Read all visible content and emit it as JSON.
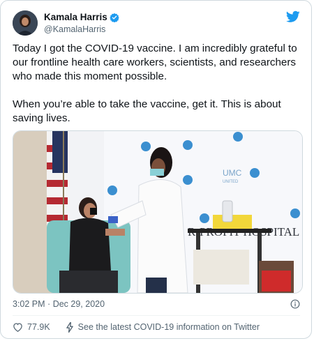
{
  "author": {
    "name": "Kamala Harris",
    "handle": "@KamalaHarris",
    "verified_icon": "verified-badge-icon"
  },
  "brand_color": "#1d9bf0",
  "tweet": {
    "text": "Today I got the COVID-19 vaccine. I am incredibly grateful to our frontline health care workers, scientists, and researchers who made this moment possible.\n\nWhen you’re able to take the vaccine, get it. This is about saving lives.",
    "time": "3:02 PM",
    "separator": "·",
    "date": "Dec 29, 2020"
  },
  "photo": {
    "backdrop_logo": "UMC",
    "backdrop_sub": "UNITED",
    "backdrop_banner": "R-PROFIT HOSPITAL CORPO"
  },
  "actions": {
    "likes": "77.9K",
    "covid_info": "See the latest COVID-19 information on Twitter"
  }
}
